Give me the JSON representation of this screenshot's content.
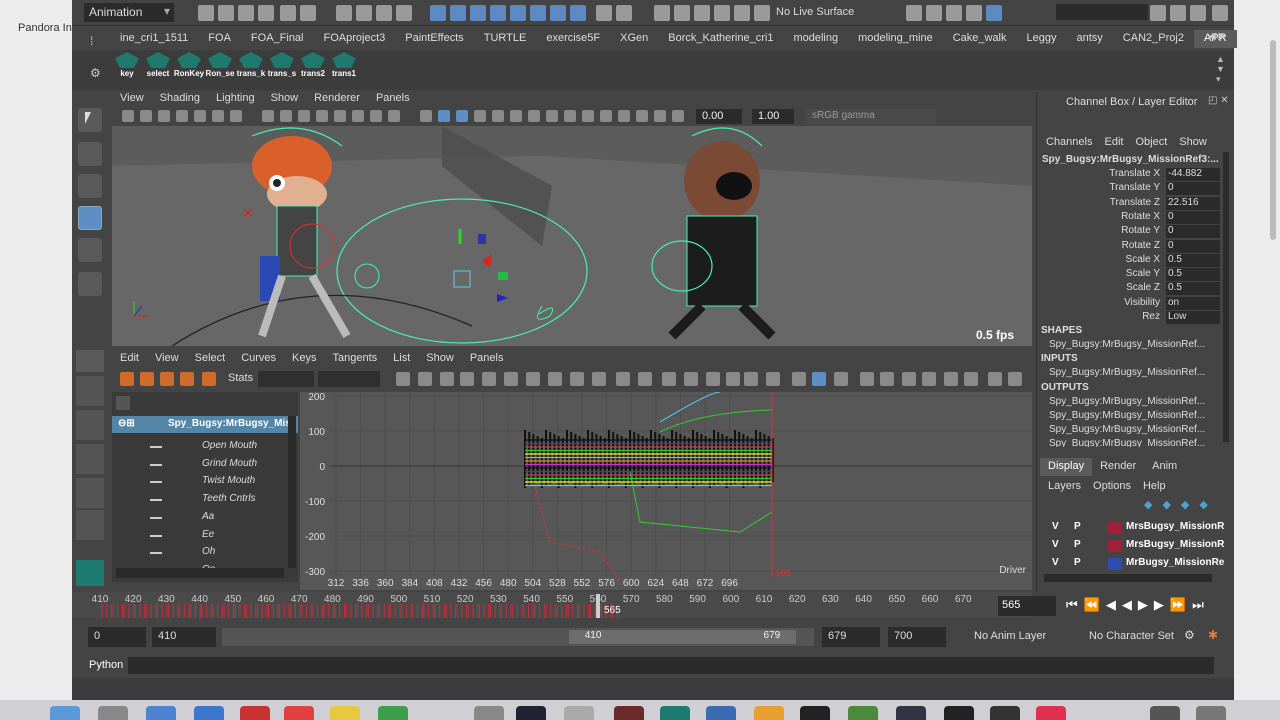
{
  "mac": {
    "left_tab": "Pandora In"
  },
  "toolbar": {
    "mode_menu": "Animation",
    "live_surface": "No Live Surface"
  },
  "shelf": {
    "tabs": [
      "ine_cri1_1511",
      "FOA",
      "FOA_Final",
      "FOAproject3",
      "PaintEffects",
      "TURTLE",
      "exercise5F",
      "XGen",
      "Borck_Katherine_cri1",
      "modeling",
      "modeling_mine",
      "Cake_walk",
      "Leggy",
      "antsy",
      "CAN2_Proj2",
      "APR"
    ],
    "active_tab": "APR",
    "buttons": [
      "key",
      "select",
      "RonKey",
      "Ron_se",
      "trans_k",
      "trans_s",
      "trans2",
      "trans1"
    ]
  },
  "viewport": {
    "menu": [
      "View",
      "Shading",
      "Lighting",
      "Show",
      "Renderer",
      "Panels"
    ],
    "field1": "0.00",
    "field2": "1.00",
    "color_space": "sRGB gamma",
    "fps": "0.5 fps"
  },
  "graph_editor": {
    "menu": [
      "Edit",
      "View",
      "Select",
      "Curves",
      "Keys",
      "Tangents",
      "List",
      "Show",
      "Panels"
    ],
    "stats_label": "Stats",
    "outliner": {
      "object": "Spy_Bugsy:MrBugsy_Mis",
      "attributes": [
        "Open Mouth",
        "Grind Mouth",
        "Twist Mouth",
        "Teeth Cntrls",
        "Aa",
        "Ee",
        "Oh",
        "Oo"
      ]
    },
    "y_ticks": [
      "200",
      "100",
      "0",
      "-100",
      "-200",
      "-300"
    ],
    "x_ticks": [
      "312",
      "336",
      "360",
      "384",
      "408",
      "432",
      "456",
      "480",
      "504",
      "528",
      "552",
      "576",
      "600",
      "624",
      "648",
      "672",
      "696"
    ],
    "current_marker": "565",
    "driver_label": "Driver"
  },
  "timeline": {
    "ticks": [
      "410",
      "420",
      "430",
      "440",
      "450",
      "460",
      "470",
      "480",
      "490",
      "500",
      "510",
      "520",
      "530",
      "540",
      "550",
      "560",
      "570",
      "580",
      "590",
      "600",
      "610",
      "620",
      "630",
      "640",
      "650",
      "660",
      "670"
    ],
    "current_frame": "565",
    "current_marker": "565"
  },
  "range": {
    "start": "0",
    "range_start": "410",
    "slider_start": "410",
    "slider_end": "679",
    "range_end": "679",
    "end": "700",
    "anim_layer": "No Anim Layer",
    "character_set": "No Character Set"
  },
  "command_line": {
    "label": "Python"
  },
  "channel_box": {
    "title": "Channel Box / Layer Editor",
    "menu": [
      "Channels",
      "Edit",
      "Object",
      "Show"
    ],
    "object_name": "Spy_Bugsy:MrBugsy_MissionRef3:...",
    "channels": [
      {
        "label": "Translate X",
        "value": "-44.882"
      },
      {
        "label": "Translate Y",
        "value": "0"
      },
      {
        "label": "Translate Z",
        "value": "22.516"
      },
      {
        "label": "Rotate X",
        "value": "0"
      },
      {
        "label": "Rotate Y",
        "value": "0"
      },
      {
        "label": "Rotate Z",
        "value": "0"
      },
      {
        "label": "Scale X",
        "value": "0.5"
      },
      {
        "label": "Scale Y",
        "value": "0.5"
      },
      {
        "label": "Scale Z",
        "value": "0.5"
      },
      {
        "label": "Visibility",
        "value": "on"
      },
      {
        "label": "Rez",
        "value": "Low"
      }
    ],
    "shapes_title": "SHAPES",
    "shapes": [
      "Spy_Bugsy:MrBugsy_MissionRef..."
    ],
    "inputs_title": "INPUTS",
    "inputs": [
      "Spy_Bugsy:MrBugsy_MissionRef..."
    ],
    "outputs_title": "OUTPUTS",
    "outputs": [
      "Spy_Bugsy:MrBugsy_MissionRef...",
      "Spy_Bugsy:MrBugsy_MissionRef...",
      "Spy_Bugsy:MrBugsy_MissionRef...",
      "Spy_Bugsy:MrBugsy_MissionRef..."
    ]
  },
  "layer_editor": {
    "tabs": [
      "Display",
      "Render",
      "Anim"
    ],
    "active_tab": "Display",
    "menu": [
      "Layers",
      "Options",
      "Help"
    ],
    "layers": [
      {
        "v": "V",
        "p": "P",
        "name": "MrsBugsy_MissionR",
        "color": "#a0203a"
      },
      {
        "v": "V",
        "p": "P",
        "name": "MrsBugsy_MissionR",
        "color": "#a0203a"
      },
      {
        "v": "V",
        "p": "P",
        "name": "MrBugsy_MissionRe",
        "color": "#2a4fb0"
      }
    ]
  },
  "colors": {
    "accent": "#5285a6",
    "timeline_key": "#c0303a",
    "current_time": "#e03030"
  }
}
